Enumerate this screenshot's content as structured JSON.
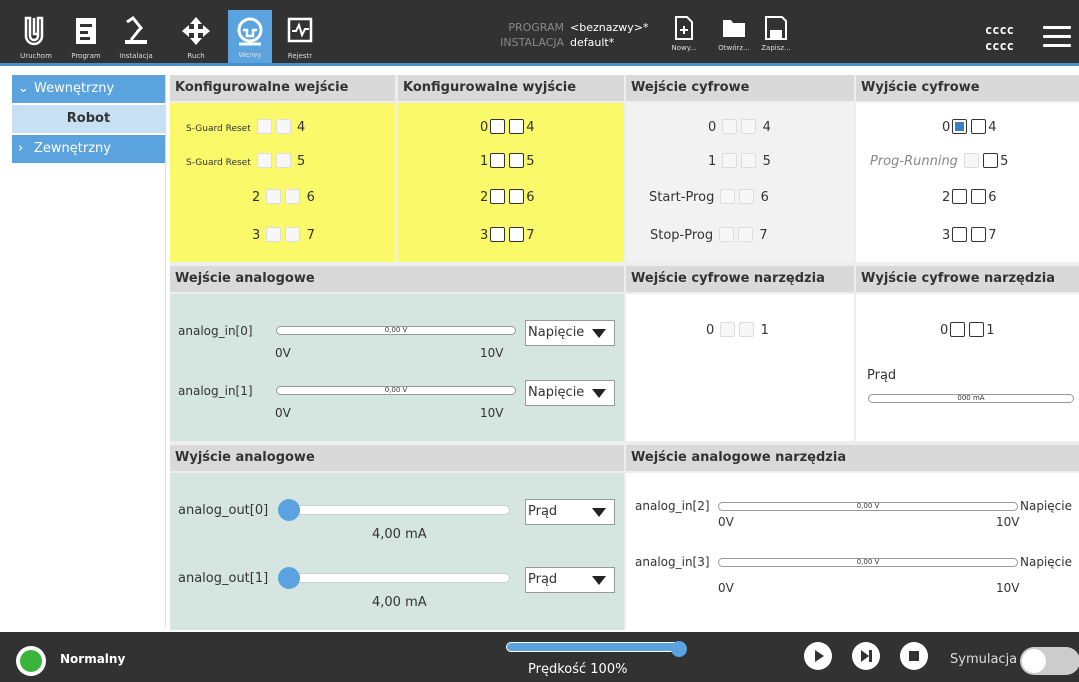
{
  "nav": [
    {
      "label": "Uruchom",
      "icon": "run-icon"
    },
    {
      "label": "Program",
      "icon": "program-icon"
    },
    {
      "label": "Instalacja",
      "icon": "installation-icon"
    },
    {
      "label": "Ruch",
      "icon": "move-icon"
    },
    {
      "label": "We/wy",
      "icon": "io-icon",
      "active": true
    },
    {
      "label": "Rejestr",
      "icon": "log-icon"
    }
  ],
  "program": {
    "program_key": "PROGRAM",
    "program_val": "<beznazwy>*",
    "install_key": "INSTALACJA",
    "install_val": "default*"
  },
  "file": {
    "new": "Nowy...",
    "open": "Otwórz...",
    "save": "Zapisz..."
  },
  "user": {
    "line1": "cccc",
    "line2": "cccc"
  },
  "sidebar": {
    "internal": "Wewnętrzny",
    "robot": "Robot",
    "external": "Zewnętrzny"
  },
  "panels": {
    "config_in": "Konfigurowalne wejście",
    "config_out": "Konfigurowalne wyjście",
    "digital_in": "Wejście cyfrowe",
    "digital_out": "Wyjście cyfrowe",
    "analog_in": "Wejście analogowe",
    "tool_din": "Wejście cyfrowe narzędzia",
    "tool_dout": "Wyjście cyfrowe narzędzia",
    "analog_out": "Wyjście analogowe",
    "tool_ain": "Wejście analogowe narzędzia"
  },
  "config_in": {
    "r1": "S-Guard Reset",
    "r2": "S-Guard Reset",
    "n4": "4",
    "n5": "5",
    "n2": "2",
    "n6": "6",
    "n3": "3",
    "n7": "7"
  },
  "config_out": {
    "n0": "0",
    "n4": "4",
    "n1": "1",
    "n5": "5",
    "n2": "2",
    "n6": "6",
    "n3": "3",
    "n7": "7"
  },
  "digital_in": {
    "n0": "0",
    "n4": "4",
    "n1": "1",
    "n5": "5",
    "start": "Start-Prog",
    "n6": "6",
    "stop": "Stop-Prog",
    "n7": "7"
  },
  "digital_out": {
    "n0": "0",
    "n4": "4",
    "prog": "Prog-Running",
    "n5": "5",
    "n2": "2",
    "n6": "6",
    "n3": "3",
    "n7": "7"
  },
  "analog_in": [
    {
      "name": "analog_in[0]",
      "value": "0,00 V",
      "min": "0V",
      "max": "10V",
      "mode": "Napięcie"
    },
    {
      "name": "analog_in[1]",
      "value": "0,00 V",
      "min": "0V",
      "max": "10V",
      "mode": "Napięcie"
    }
  ],
  "tool_din": {
    "n0": "0",
    "n1": "1"
  },
  "tool_dout": {
    "n0": "0",
    "n1": "1",
    "current_label": "Prąd",
    "current_value": "000 mA"
  },
  "analog_out": [
    {
      "name": "analog_out[0]",
      "value": "4,00 mA",
      "mode": "Prąd"
    },
    {
      "name": "analog_out[1]",
      "value": "4,00 mA",
      "mode": "Prąd"
    }
  ],
  "tool_ain": [
    {
      "name": "analog_in[2]",
      "value": "0,00 V",
      "min": "0V",
      "max": "10V",
      "mode": "Napięcie"
    },
    {
      "name": "analog_in[3]",
      "value": "0,00 V",
      "min": "0V",
      "max": "10V",
      "mode": "Napięcie"
    }
  ],
  "bottom": {
    "status": "Normalny",
    "speed": "Prędkość 100%",
    "sim": "Symulacja"
  }
}
